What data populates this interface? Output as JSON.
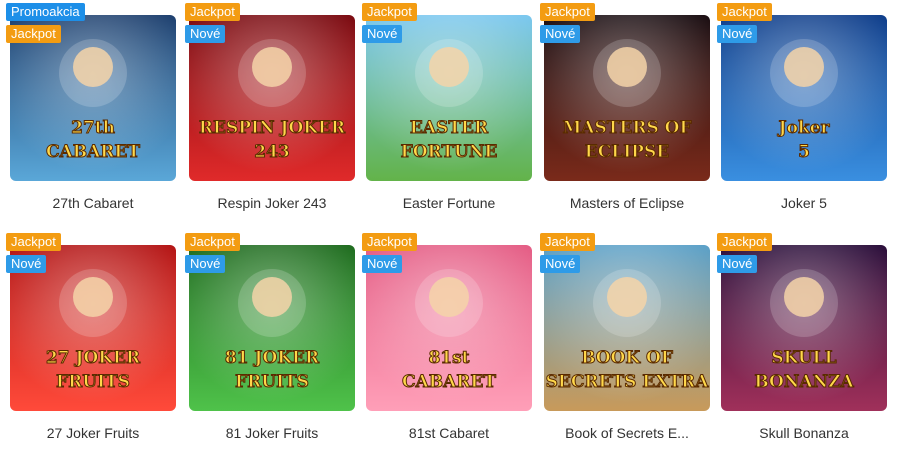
{
  "badges": {
    "promo": "Promoakcia",
    "jackpot": "Jackpot",
    "new": "Nové"
  },
  "games": [
    {
      "title": "27th Cabaret",
      "art": "27th CABARET",
      "promo": true,
      "jackpot": true,
      "new": false,
      "colors": [
        "#1d3f6e",
        "#5aa7d8"
      ]
    },
    {
      "title": "Respin Joker 243",
      "art": "RESPIN JOKER 243",
      "promo": false,
      "jackpot": true,
      "new": true,
      "colors": [
        "#7a0a10",
        "#e02a2a"
      ]
    },
    {
      "title": "Easter Fortune",
      "art": "EASTER FORTUNE",
      "promo": false,
      "jackpot": true,
      "new": true,
      "colors": [
        "#7ac7f0",
        "#63b34a"
      ]
    },
    {
      "title": "Masters of Eclipse",
      "art": "MASTERS OF ECLIPSE",
      "promo": false,
      "jackpot": true,
      "new": true,
      "colors": [
        "#1a0e12",
        "#7a2a1a"
      ]
    },
    {
      "title": "Joker 5",
      "art": "Joker 5",
      "promo": false,
      "jackpot": true,
      "new": true,
      "colors": [
        "#0e3d8a",
        "#3a8fe0"
      ]
    },
    {
      "title": "27 Joker Fruits",
      "art": "27 JOKER FRUITS",
      "promo": false,
      "jackpot": true,
      "new": true,
      "colors": [
        "#b31414",
        "#ff4a3a"
      ]
    },
    {
      "title": "81 Joker Fruits",
      "art": "81 JOKER FRUITS",
      "promo": false,
      "jackpot": true,
      "new": true,
      "colors": [
        "#1e6b1e",
        "#4fc24a"
      ]
    },
    {
      "title": "81st Cabaret",
      "art": "81st CABARET",
      "promo": false,
      "jackpot": true,
      "new": true,
      "colors": [
        "#e45c84",
        "#ff9fb8"
      ]
    },
    {
      "title": "Book of Secrets E...",
      "art": "BOOK OF SECRETS EXTRA",
      "promo": false,
      "jackpot": true,
      "new": true,
      "colors": [
        "#5aa0c8",
        "#c89a5a"
      ]
    },
    {
      "title": "Skull Bonanza",
      "art": "SKULL BONANZA",
      "promo": false,
      "jackpot": true,
      "new": true,
      "colors": [
        "#2a0e3a",
        "#a0305a"
      ]
    }
  ]
}
